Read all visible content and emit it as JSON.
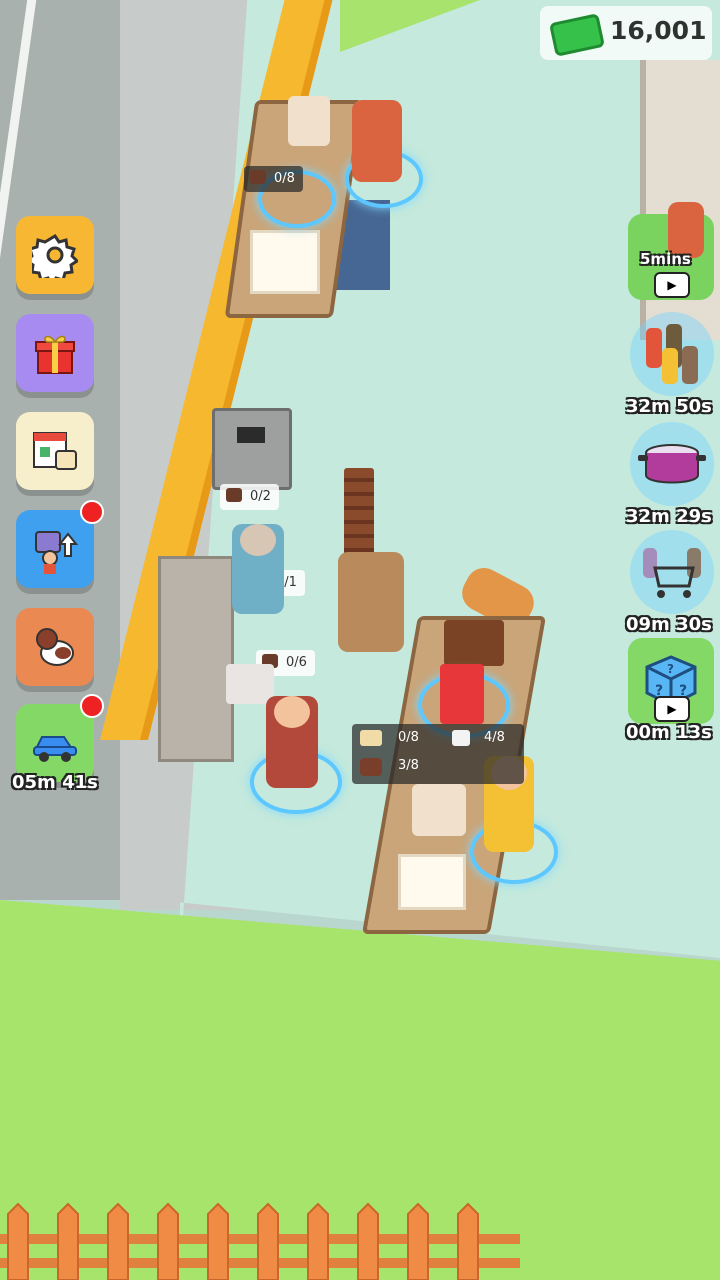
{
  "hud": {
    "cash_value": "16,001",
    "cash_icon": "cash-stack-icon"
  },
  "left_buttons": {
    "settings_icon": "gear-icon",
    "gift_icon": "gift-icon",
    "shop_icon": "shop-icon",
    "staff_upgrade_icon": "staff-upgrade-icon",
    "dog_icon": "dog-icon",
    "car_icon": "car-icon",
    "car_timer": "05m 41s"
  },
  "right_buttons": {
    "ad_customer_label": "5mins",
    "customers_timer": "32m 50s",
    "pot_timer": "32m 29s",
    "cart_timer": "09m 30s",
    "mystery_box_timer": "00m 13s"
  },
  "stations": {
    "top_counter_progress": "0/8",
    "bin_progress": "0/2",
    "shelf_progress_1": "0/1",
    "shelf_progress_2": "0/6",
    "recipe": {
      "bread": "0/8",
      "cup": "4/8",
      "cake": "3/8"
    }
  },
  "colors": {
    "accent_yellow": "#f5b82e",
    "grass": "#a6e46c",
    "floor": "#c5e9dc",
    "cash_green": "#36c24a"
  }
}
